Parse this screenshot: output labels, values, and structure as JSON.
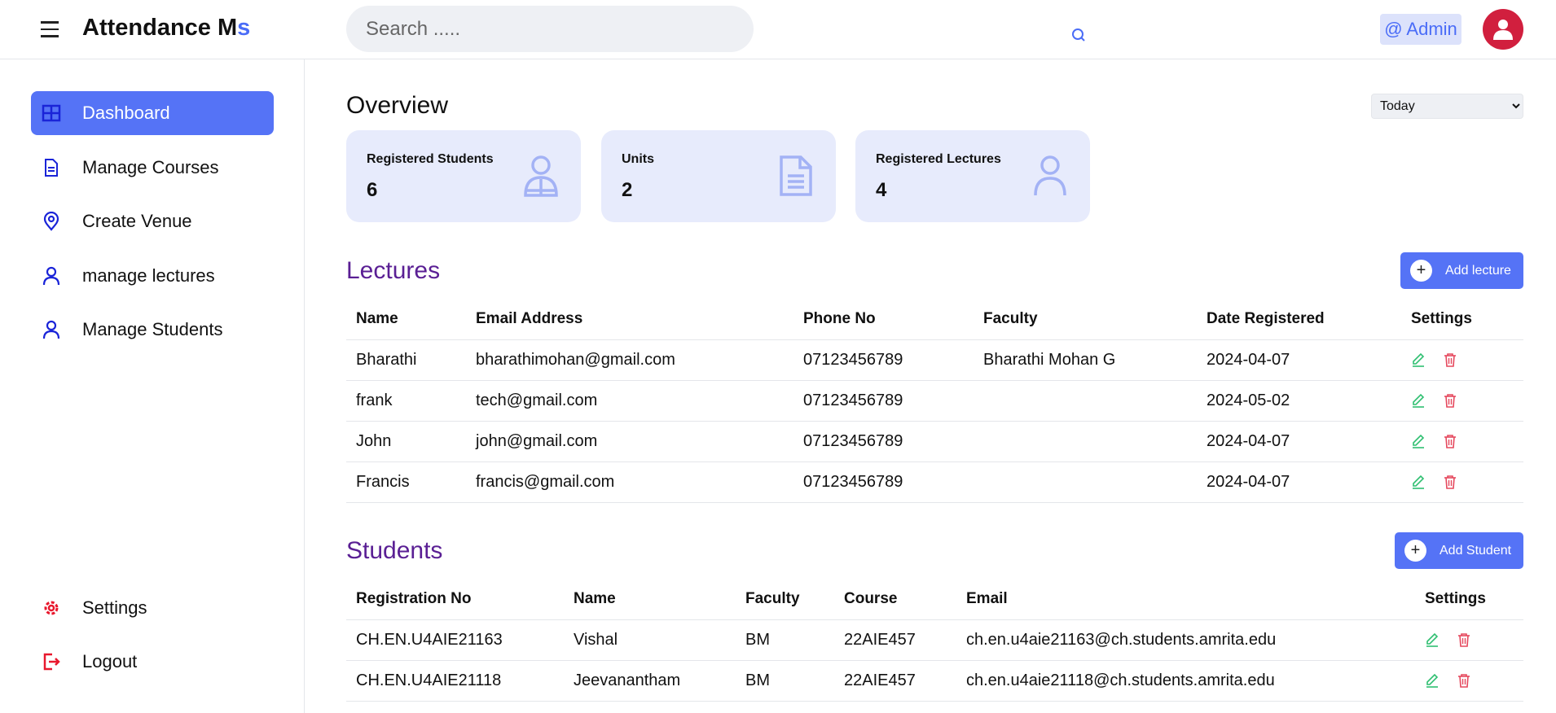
{
  "header": {
    "brand_main": "Attendance M",
    "brand_accent": "s",
    "search_placeholder": "Search .....",
    "admin_label": "@ Admin"
  },
  "sidebar": {
    "items": [
      {
        "label": "Dashboard",
        "icon": "grid-icon"
      },
      {
        "label": "Manage Courses",
        "icon": "document-icon"
      },
      {
        "label": "Create Venue",
        "icon": "location-pin-icon"
      },
      {
        "label": "manage lectures",
        "icon": "user-icon"
      },
      {
        "label": "Manage Students",
        "icon": "user-icon"
      }
    ],
    "settings_label": "Settings",
    "logout_label": "Logout"
  },
  "overview": {
    "title": "Overview",
    "period": "Today",
    "period_options": [
      "Today"
    ],
    "cards": [
      {
        "title": "Registered Students",
        "value": "6",
        "icon": "student-icon"
      },
      {
        "title": "Units",
        "value": "2",
        "icon": "document-icon"
      },
      {
        "title": "Registered Lectures",
        "value": "4",
        "icon": "user-icon"
      }
    ]
  },
  "lectures": {
    "title": "Lectures",
    "add_label": "Add lecture",
    "columns": [
      "Name",
      "Email Address",
      "Phone No",
      "Faculty",
      "Date Registered",
      "Settings"
    ],
    "rows": [
      [
        "Bharathi",
        "bharathimohan@gmail.com",
        "07123456789",
        "Bharathi Mohan G",
        "2024-04-07"
      ],
      [
        "frank",
        "tech@gmail.com",
        "07123456789",
        "",
        "2024-05-02"
      ],
      [
        "John",
        "john@gmail.com",
        "07123456789",
        "",
        "2024-04-07"
      ],
      [
        "Francis",
        "francis@gmail.com",
        "07123456789",
        "",
        "2024-04-07"
      ]
    ]
  },
  "students": {
    "title": "Students",
    "add_label": "Add Student",
    "columns": [
      "Registration No",
      "Name",
      "Faculty",
      "Course",
      "Email",
      "Settings"
    ],
    "rows": [
      [
        "CH.EN.U4AIE21163",
        "Vishal",
        "BM",
        "22AIE457",
        "ch.en.u4aie21163@ch.students.amrita.edu"
      ],
      [
        "CH.EN.U4AIE21118",
        "Jeevanantham",
        "BM",
        "22AIE457",
        "ch.en.u4aie21118@ch.students.amrita.edu"
      ]
    ]
  },
  "colors": {
    "accent": "#5573f6",
    "section_title": "#5a1f94",
    "edit": "#2fbf71",
    "delete": "#e5485d",
    "avatar": "#d11f3e"
  }
}
